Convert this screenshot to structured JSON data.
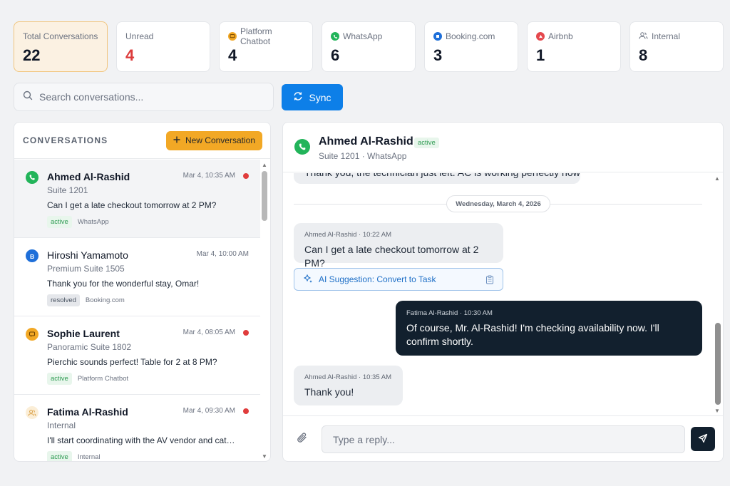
{
  "stats": [
    {
      "label": "Total Conversations",
      "value": "22",
      "icon": "",
      "active": true
    },
    {
      "label": "Unread",
      "value": "4",
      "icon": "",
      "value_color": "#dc3b3b"
    },
    {
      "label": "Platform Chatbot",
      "value": "4",
      "icon": "chatbot-icon"
    },
    {
      "label": "WhatsApp",
      "value": "6",
      "icon": "whatsapp-icon"
    },
    {
      "label": "Booking.com",
      "value": "3",
      "icon": "booking-icon"
    },
    {
      "label": "Airbnb",
      "value": "1",
      "icon": "airbnb-icon"
    },
    {
      "label": "Internal",
      "value": "8",
      "icon": "internal-users-icon"
    }
  ],
  "search": {
    "placeholder": "Search conversations..."
  },
  "sync": {
    "label": "Sync"
  },
  "conversations_panel": {
    "title": "CONVERSATIONS",
    "new_button": "New Conversation",
    "items": [
      {
        "name": "Ahmed Al-Rashid",
        "unit": "Suite 1201",
        "time": "Mar 4, 10:35 AM",
        "message": "Can I get a late checkout tomorrow at 2 PM?",
        "status": "active",
        "channel": "WhatsApp",
        "unread": true,
        "selected": true,
        "icon": "whatsapp-icon"
      },
      {
        "name": "Hiroshi Yamamoto",
        "unit": "Premium Suite 1505",
        "time": "Mar 4, 10:00 AM",
        "message": "Thank you for the wonderful stay, Omar!",
        "status": "resolved",
        "channel": "Booking.com",
        "unread": false,
        "selected": false,
        "icon": "booking-icon"
      },
      {
        "name": "Sophie Laurent",
        "unit": "Panoramic Suite 1802",
        "time": "Mar 4, 08:05 AM",
        "message": "Pierchic sounds perfect! Table for 2 at 8 PM?",
        "status": "active",
        "channel": "Platform Chatbot",
        "unread": true,
        "selected": false,
        "icon": "chatbot-icon"
      },
      {
        "name": "Fatima Al-Rashid",
        "unit": "Internal",
        "time": "Mar 4, 09:30 AM",
        "message": "I'll start coordinating with the AV vendor and catering...",
        "status": "active",
        "channel": "Internal",
        "unread": true,
        "selected": false,
        "icon": "internal-users-icon"
      }
    ]
  },
  "chat": {
    "name": "Ahmed Al-Rashid",
    "status": "active",
    "subtitle": "Suite 1201 · WhatsApp",
    "partial_message": "Thank you, the technician just left. AC is working perfectly now.",
    "date_divider": "Wednesday, March 4, 2026",
    "messages": [
      {
        "meta": "Ahmed Al-Rashid · 10:22 AM",
        "text": "Can I get a late checkout tomorrow at 2 PM?",
        "direction": "in"
      },
      {
        "meta": "Fatima Al-Rashid · 10:30 AM",
        "text": "Of course, Mr. Al-Rashid! I'm checking availability now. I'll confirm shortly.",
        "direction": "out"
      },
      {
        "meta": "Ahmed Al-Rashid · 10:35 AM",
        "text": "Thank you!",
        "direction": "in"
      }
    ],
    "ai_suggestion": "AI Suggestion: Convert to Task",
    "reply_placeholder": "Type a reply..."
  },
  "colors": {
    "accent_blue": "#0d7fe8",
    "accent_orange": "#f2a825",
    "unread_red": "#e03c3c",
    "whatsapp_green": "#22b45a",
    "booking_blue": "#1e6fd9",
    "airbnb_red": "#e5484d",
    "dark_bubble": "#12202e"
  }
}
